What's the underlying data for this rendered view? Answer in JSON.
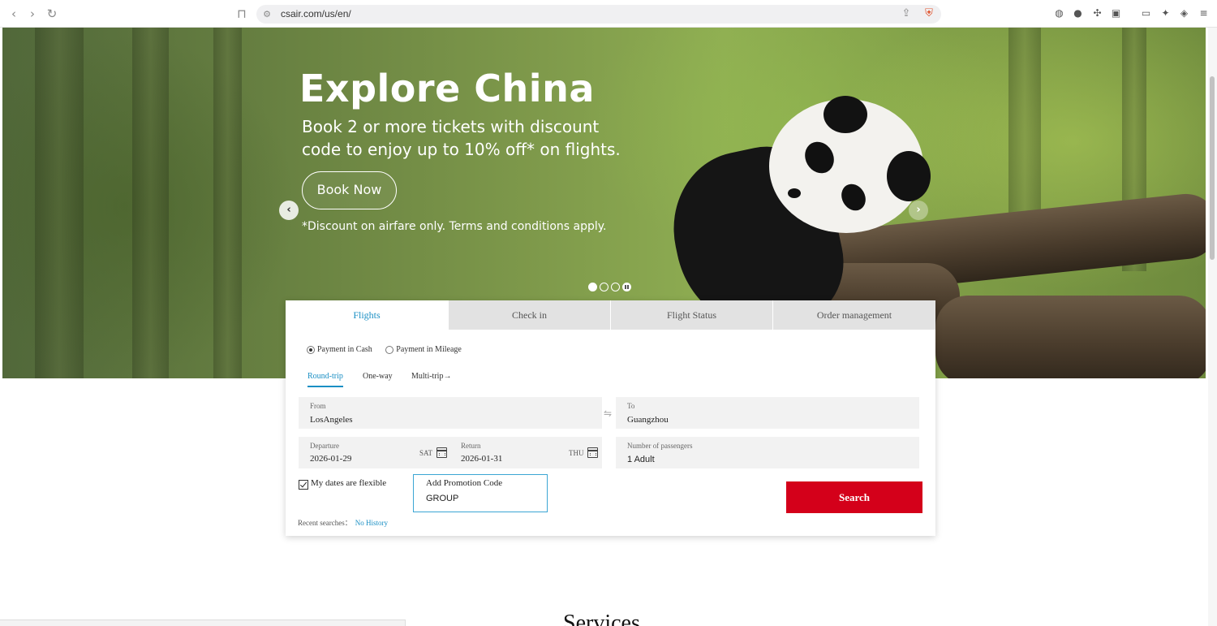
{
  "browser": {
    "url": "csair.com/us/en/",
    "back_icon": "‹",
    "forward_icon": "›",
    "reload_icon": "↻",
    "bookmark_icon": "⊓",
    "share_icon": "⇪",
    "menu_icon": "≡"
  },
  "hero": {
    "title": "Explore China",
    "subtitle": "Book 2 or more tickets with discount code to enjoy up to 10% off* on flights.",
    "cta_label": "Book Now",
    "note": "*Discount on airfare only. Terms and conditions apply.",
    "prev_icon": "‹",
    "next_icon": "›"
  },
  "booking": {
    "tabs": [
      {
        "label": "Flights"
      },
      {
        "label": "Check in"
      },
      {
        "label": "Flight Status"
      },
      {
        "label": "Order management"
      }
    ],
    "payment": {
      "cash_label": "Payment in Cash",
      "mileage_label": "Payment in Mileage"
    },
    "trip_types": {
      "round": "Round-trip",
      "one": "One-way",
      "multi": "Multi-trip→"
    },
    "from": {
      "label": "From",
      "value": "LosAngeles"
    },
    "to": {
      "label": "To",
      "value": "Guangzhou"
    },
    "swap_icon": "⇋",
    "departure": {
      "label": "Departure",
      "value": "2026-01-29",
      "day": "SAT"
    },
    "return": {
      "label": "Return",
      "value": "2026-01-31",
      "day": "THU"
    },
    "passengers": {
      "label": "Number of passengers",
      "value": "1 Adult"
    },
    "flexible_label": "My dates are flexible",
    "promo": {
      "label": "Add Promotion Code",
      "value": "GROUP"
    },
    "search_label": "Search",
    "recent_label": "Recent searches：",
    "recent_link": "No History"
  },
  "services_heading": "Services"
}
